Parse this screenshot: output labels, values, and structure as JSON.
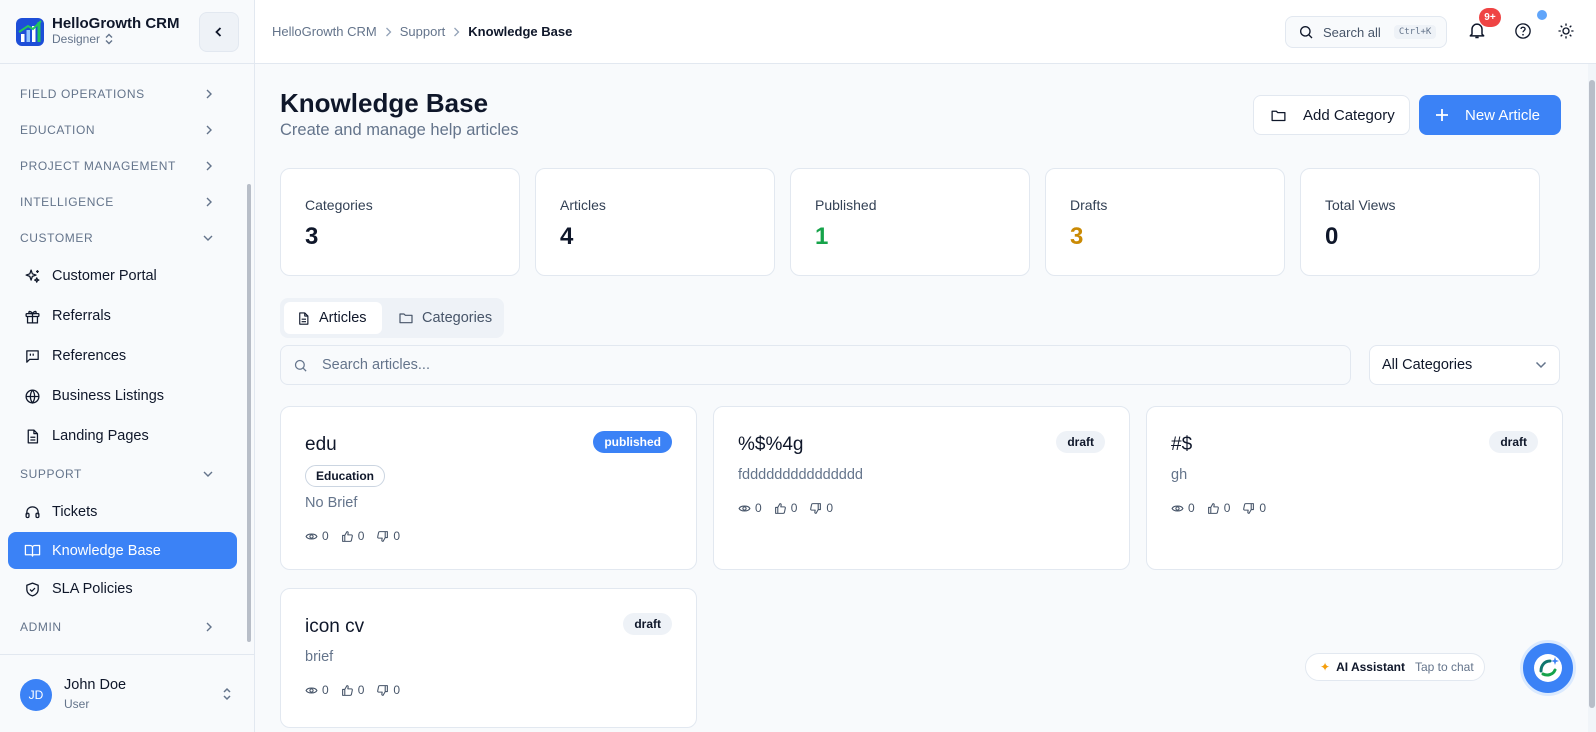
{
  "brand": {
    "name": "HelloGrowth CRM",
    "role": "Designer"
  },
  "sidebar": {
    "sections": [
      {
        "label": "FIELD OPERATIONS"
      },
      {
        "label": "EDUCATION"
      },
      {
        "label": "PROJECT MANAGEMENT"
      },
      {
        "label": "INTELLIGENCE"
      },
      {
        "label": "CUSTOMER"
      },
      {
        "label": "SUPPORT"
      },
      {
        "label": "ADMIN"
      }
    ],
    "customer_items": [
      {
        "label": "Customer Portal",
        "icon": "sparkles-icon"
      },
      {
        "label": "Referrals",
        "icon": "gift-icon"
      },
      {
        "label": "References",
        "icon": "message-quote-icon"
      },
      {
        "label": "Business Listings",
        "icon": "globe-icon"
      },
      {
        "label": "Landing Pages",
        "icon": "file-text-icon"
      }
    ],
    "support_items": [
      {
        "label": "Tickets",
        "icon": "headset-icon"
      },
      {
        "label": "Knowledge Base",
        "icon": "book-open-icon",
        "active": true
      },
      {
        "label": "SLA Policies",
        "icon": "shield-check-icon"
      }
    ]
  },
  "user": {
    "initials": "JD",
    "name": "John Doe",
    "role": "User"
  },
  "topbar": {
    "breadcrumbs": [
      "HelloGrowth CRM",
      "Support",
      "Knowledge Base"
    ],
    "search_label": "Search all",
    "search_shortcut": "Ctrl+K",
    "notification_badge": "9+"
  },
  "page": {
    "title": "Knowledge Base",
    "subtitle": "Create and manage help articles",
    "add_category_label": "Add Category",
    "new_article_label": "New Article"
  },
  "stats": [
    {
      "label": "Categories",
      "value": "3",
      "color": "#0f172a"
    },
    {
      "label": "Articles",
      "value": "4",
      "color": "#0f172a"
    },
    {
      "label": "Published",
      "value": "1",
      "color": "#16a34a"
    },
    {
      "label": "Drafts",
      "value": "3",
      "color": "#ca8a04"
    },
    {
      "label": "Total Views",
      "value": "0",
      "color": "#0f172a"
    }
  ],
  "tabs": [
    {
      "label": "Articles",
      "active": true
    },
    {
      "label": "Categories",
      "active": false
    }
  ],
  "filters": {
    "search_placeholder": "Search articles...",
    "category_selected": "All Categories"
  },
  "articles": [
    {
      "title": "edu",
      "status": "published",
      "category": "Education",
      "brief": "No Brief",
      "views": "0",
      "likes": "0",
      "dislikes": "0"
    },
    {
      "title": "%$%4g",
      "status": "draft",
      "category": "",
      "brief": "fddddddddddddddd",
      "views": "0",
      "likes": "0",
      "dislikes": "0"
    },
    {
      "title": "#$",
      "status": "draft",
      "category": "",
      "brief": "gh",
      "views": "0",
      "likes": "0",
      "dislikes": "0"
    },
    {
      "title": "icon cv",
      "status": "draft",
      "category": "",
      "brief": "brief",
      "views": "0",
      "likes": "0",
      "dislikes": "0"
    }
  ],
  "assistant": {
    "label": "AI Assistant",
    "hint": "Tap to chat"
  }
}
